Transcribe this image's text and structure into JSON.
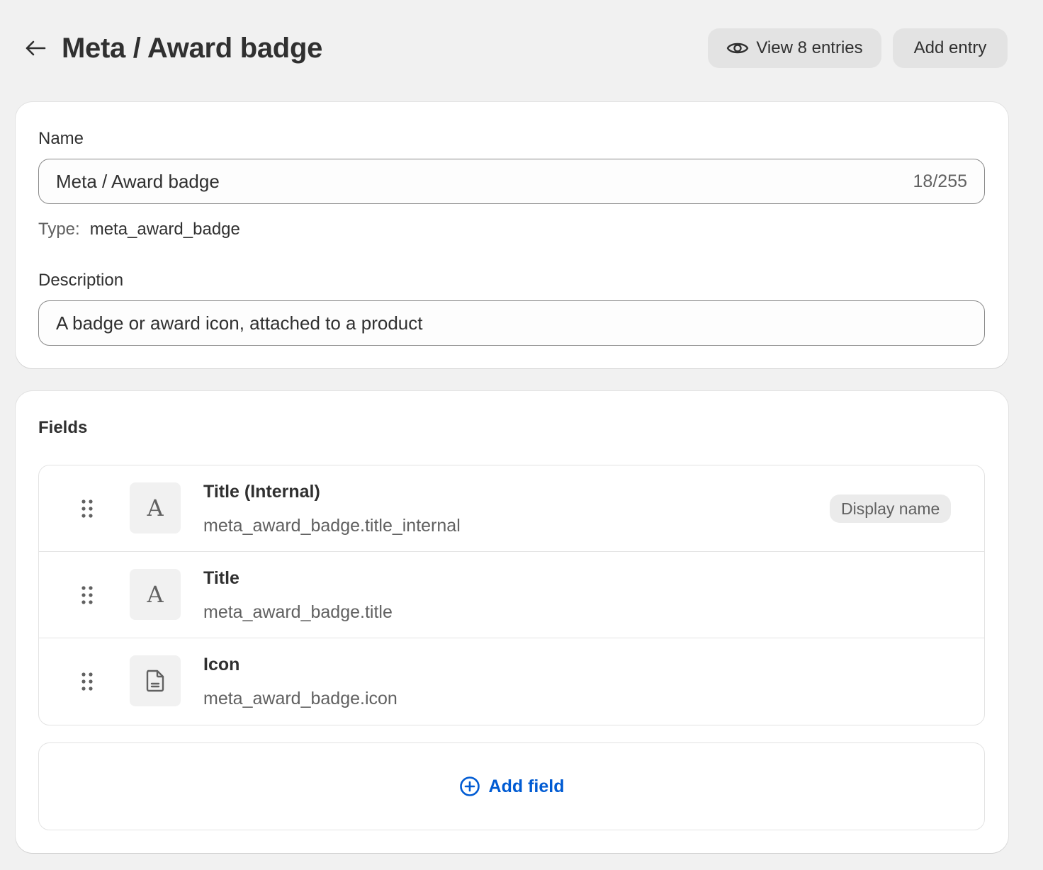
{
  "header": {
    "title": "Meta / Award badge",
    "view_entries_label": "View 8 entries",
    "add_entry_label": "Add entry"
  },
  "details": {
    "name_label": "Name",
    "name_value": "Meta / Award badge",
    "name_counter": "18/255",
    "type_label": "Type:",
    "type_value": "meta_award_badge",
    "description_label": "Description",
    "description_value": "A badge or award icon, attached to a product"
  },
  "fields": {
    "title": "Fields",
    "items": [
      {
        "name": "Title (Internal)",
        "key": "meta_award_badge.title_internal",
        "icon": "text-icon",
        "icon_glyph": "A",
        "badge": "Display name"
      },
      {
        "name": "Title",
        "key": "meta_award_badge.title",
        "icon": "text-icon",
        "icon_glyph": "A"
      },
      {
        "name": "Icon",
        "key": "meta_award_badge.icon",
        "icon": "file-icon"
      }
    ],
    "add_field_label": "Add field"
  },
  "colors": {
    "background": "#f1f1f1",
    "card": "#ffffff",
    "link": "#005bd3",
    "button": "#e3e3e3"
  }
}
